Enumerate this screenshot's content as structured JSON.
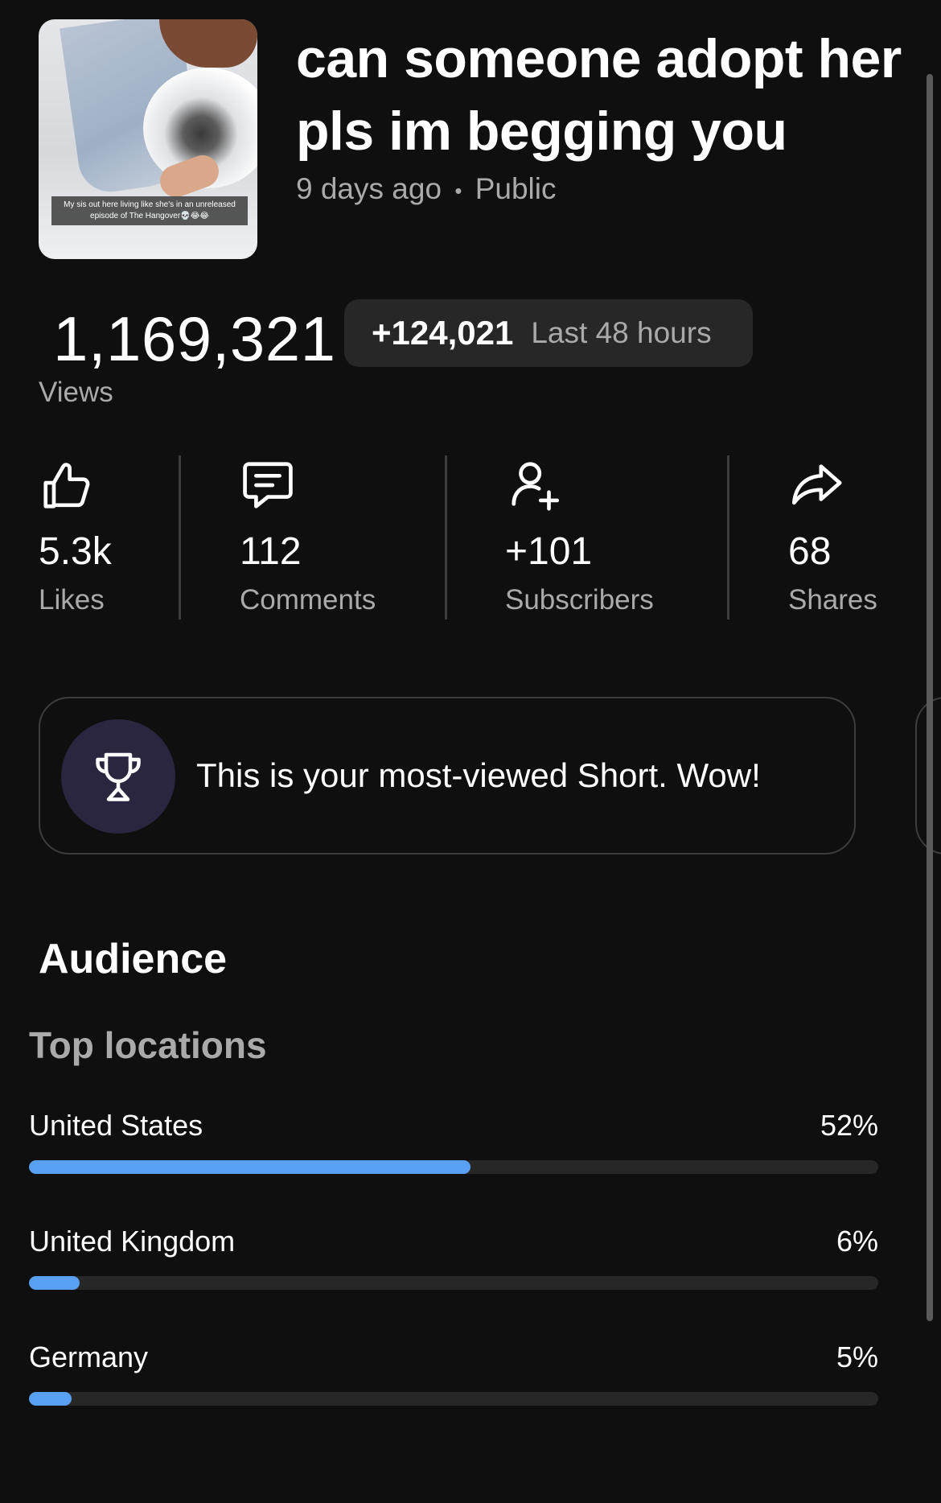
{
  "video": {
    "title": "can someone adopt her pls im begging you",
    "age": "9 days ago",
    "separator": "•",
    "visibility": "Public",
    "thumbnail_caption": "My sis out here living like she's in an unreleased episode of The Hangover💀😂😂"
  },
  "views": {
    "count": "1,169,321",
    "label": "Views",
    "delta": "+124,021",
    "delta_period": "Last 48 hours"
  },
  "stats": [
    {
      "icon": "thumbs-up-icon",
      "value": "5.3k",
      "label": "Likes"
    },
    {
      "icon": "comment-icon",
      "value": "112",
      "label": "Comments"
    },
    {
      "icon": "add-person-icon",
      "value": "+101",
      "label": "Subscribers"
    },
    {
      "icon": "share-icon",
      "value": "68",
      "label": "Shares"
    }
  ],
  "achievement": {
    "icon": "trophy-icon",
    "text": "This is your most-viewed Short. Wow!"
  },
  "audience": {
    "heading": "Audience",
    "top_locations_heading": "Top locations",
    "locations": [
      {
        "name": "United States",
        "percent_label": "52%",
        "percent": 52
      },
      {
        "name": "United Kingdom",
        "percent_label": "6%",
        "percent": 6
      },
      {
        "name": "Germany",
        "percent_label": "5%",
        "percent": 5
      }
    ]
  },
  "colors": {
    "background": "#0f0f0f",
    "secondary_text": "#aaaaaa",
    "bar_fill": "#5aa0f2",
    "bar_track": "#272727",
    "trophy_circle": "#2a2640"
  }
}
